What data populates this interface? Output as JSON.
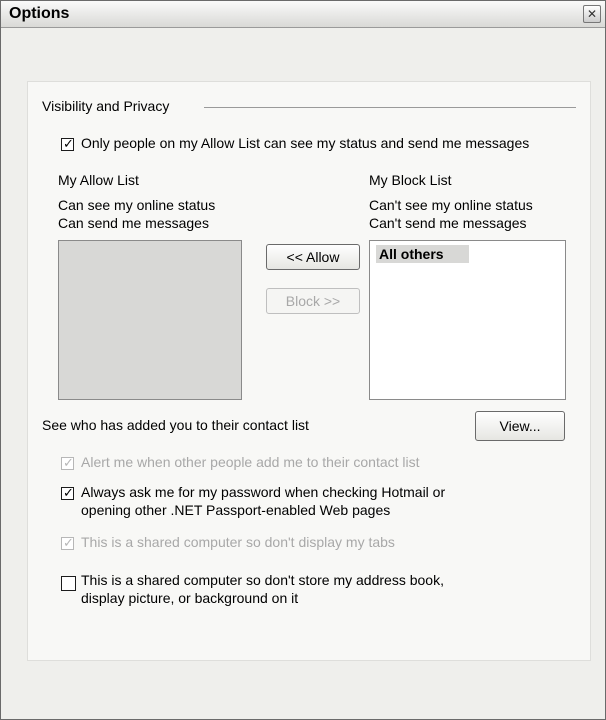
{
  "window": {
    "title": "Options"
  },
  "group": {
    "label": "Visibility and Privacy"
  },
  "opt_allow_only": {
    "checked": true,
    "label": "Only people on my Allow List can see my status and send me messages"
  },
  "allow": {
    "heading": "My Allow List",
    "line1": "Can see my online status",
    "line2": "Can send me messages"
  },
  "block": {
    "heading": "My Block List",
    "line1": "Can't see my online status",
    "line2": "Can't send me messages",
    "items": [
      "All others"
    ]
  },
  "buttons": {
    "allow": "<< Allow",
    "block": "Block >>",
    "view": "View..."
  },
  "see_who": "See who has added you to their contact list",
  "opt_alert": {
    "checked": true,
    "disabled": true,
    "label": "Alert me when other people add me to their contact list"
  },
  "opt_password": {
    "checked": true,
    "line1": "Always ask me for my password when checking Hotmail or",
    "line2": "opening other .NET Passport-enabled Web pages"
  },
  "opt_tabs": {
    "checked": true,
    "disabled": true,
    "label": "This is a shared computer so don't display my tabs"
  },
  "opt_store": {
    "checked": false,
    "line1": "This is a shared computer so don't store my address book,",
    "line2": "display picture, or background on it"
  }
}
